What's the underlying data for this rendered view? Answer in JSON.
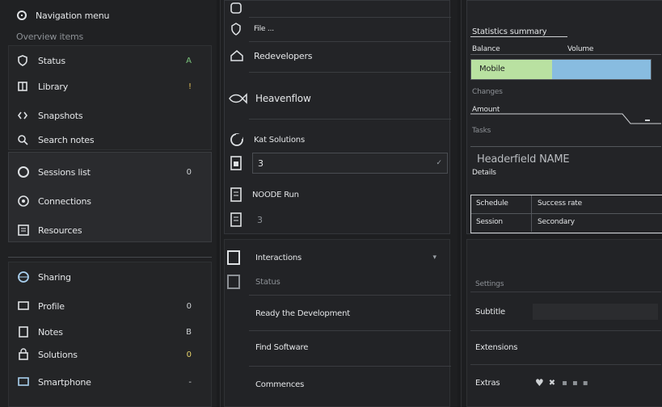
{
  "left": {
    "header": "Navigation menu",
    "section1_title": "Overview items",
    "group1": [
      {
        "icon": "shield-icon",
        "label": "Status",
        "badge": "A"
      },
      {
        "icon": "book-icon",
        "label": "Library",
        "badge": "!"
      },
      {
        "icon": "code-icon",
        "label": "Snapshots",
        "badge": ""
      },
      {
        "icon": "magnify-icon",
        "label": "Search notes",
        "badge": ""
      }
    ],
    "group2": [
      {
        "icon": "circle-icon",
        "label": "Sessions list",
        "badge": "0"
      },
      {
        "icon": "cloud-icon",
        "label": "Connections",
        "badge": ""
      },
      {
        "icon": "document-icon",
        "label": "Resources",
        "badge": ""
      }
    ],
    "group3": [
      {
        "icon": "globe-icon",
        "label": "Sharing",
        "badge": ""
      },
      {
        "icon": "monitor-icon",
        "label": "Profile",
        "badge": "0"
      },
      {
        "icon": "note-icon",
        "label": "Notes",
        "badge": "B"
      },
      {
        "icon": "lock-icon",
        "label": "Solutions",
        "badge": "0"
      },
      {
        "icon": "screen-icon",
        "label": "Smartphone",
        "badge": "-"
      }
    ]
  },
  "middle": {
    "items_top": [
      {
        "icon": "home-icon",
        "label": ""
      },
      {
        "icon": "shield-icon",
        "label": "File ..."
      },
      {
        "icon": "house-icon",
        "label": "Redevelopers"
      },
      {
        "icon": "fish-icon",
        "label": "Heavenflow"
      },
      {
        "icon": "chat-icon",
        "label": "Kat Solutions"
      }
    ],
    "input1_value": "3",
    "item_mid": {
      "icon": "file-icon",
      "label": "NOODE Run"
    },
    "input2_value": "3",
    "items_bottom": [
      {
        "icon": "frame-icon",
        "label": "Interactions"
      },
      {
        "icon": "frame-icon",
        "label": "Status"
      },
      {
        "icon": "",
        "label": "Ready the Development"
      },
      {
        "icon": "",
        "label": "Find Software"
      },
      {
        "icon": "",
        "label": "Commences"
      }
    ]
  },
  "right": {
    "title": "Statistics summary",
    "field_a_label": "Balance",
    "field_a_value": "Volume",
    "bar_label": "Mobile",
    "bar_fill_percent": 45,
    "label_changes": "Changes",
    "label_amount": "Amount",
    "label_tasks": "Tasks",
    "big_heading": "Headerfield NAME",
    "sub_heading": "Details",
    "table": [
      [
        "Schedule",
        "Success rate"
      ],
      [
        "Session",
        "Secondary"
      ]
    ],
    "section2_title": "Settings",
    "settings": [
      {
        "label": "Subtitle",
        "value": ""
      },
      {
        "label": "Extensions",
        "value": ""
      },
      {
        "label": "Extras",
        "value": "hearts"
      }
    ],
    "colors": {
      "green": "#b9e1a1",
      "blue": "#88bce0"
    }
  }
}
